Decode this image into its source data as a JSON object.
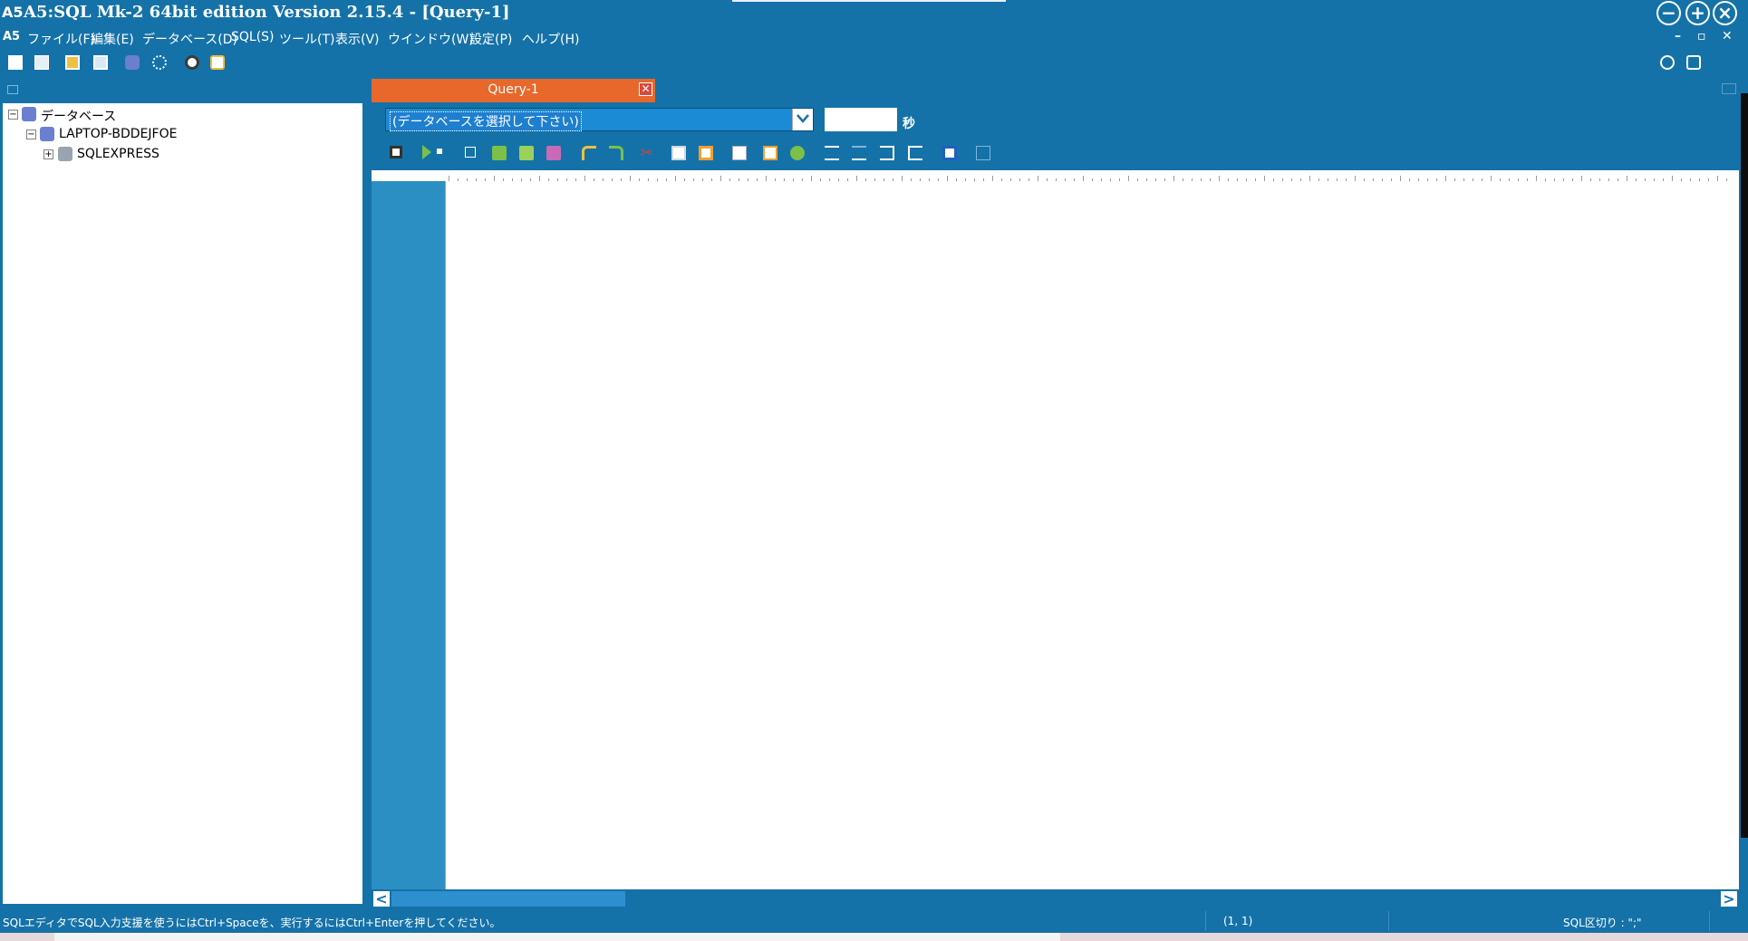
{
  "window": {
    "title": "A5:SQL Mk-2 64bit edition Version 2.15.4 - [Query-1]",
    "app_icon": "A5",
    "controls": [
      "−",
      "+",
      "×"
    ]
  },
  "menu": {
    "app_icon": "A5",
    "items": [
      "ファイル(F)",
      "編集(E)",
      "データベース(D)",
      "SQL(S)",
      "ツール(T)",
      "表示(V)",
      "ウインドウ(W)",
      "設定(P)",
      "ヘルプ(H)"
    ],
    "mdi_minimize": "–",
    "mdi_restore": "▫",
    "mdi_close": "✕"
  },
  "tree": {
    "root": "データベース",
    "server": "LAPTOP-BDDEJFOE",
    "instance": "SQLEXPRESS",
    "collapse_sign": "−",
    "expand_sign": "+"
  },
  "query_tab": {
    "label": "Query-1",
    "close": "✕"
  },
  "editor": {
    "db_select_placeholder": "(データベースを選択して下さい)",
    "timeout_value": "",
    "seconds_label": "秒"
  },
  "scrollbar": {
    "left_arrow": "<",
    "right_arrow": ">"
  },
  "status": {
    "hint": "SQLエディタでSQL入力支援を使うにはCtrl+Spaceを、実行するにはCtrl+Enterを押してください。",
    "position": "(1, 1)",
    "delimiter": "SQL区切り : \";\""
  },
  "colors": {
    "chrome": "#1572a8",
    "tab_active": "#e8672a",
    "gutter": "#2c8fc4",
    "select_bg": "#1b8bd6"
  }
}
